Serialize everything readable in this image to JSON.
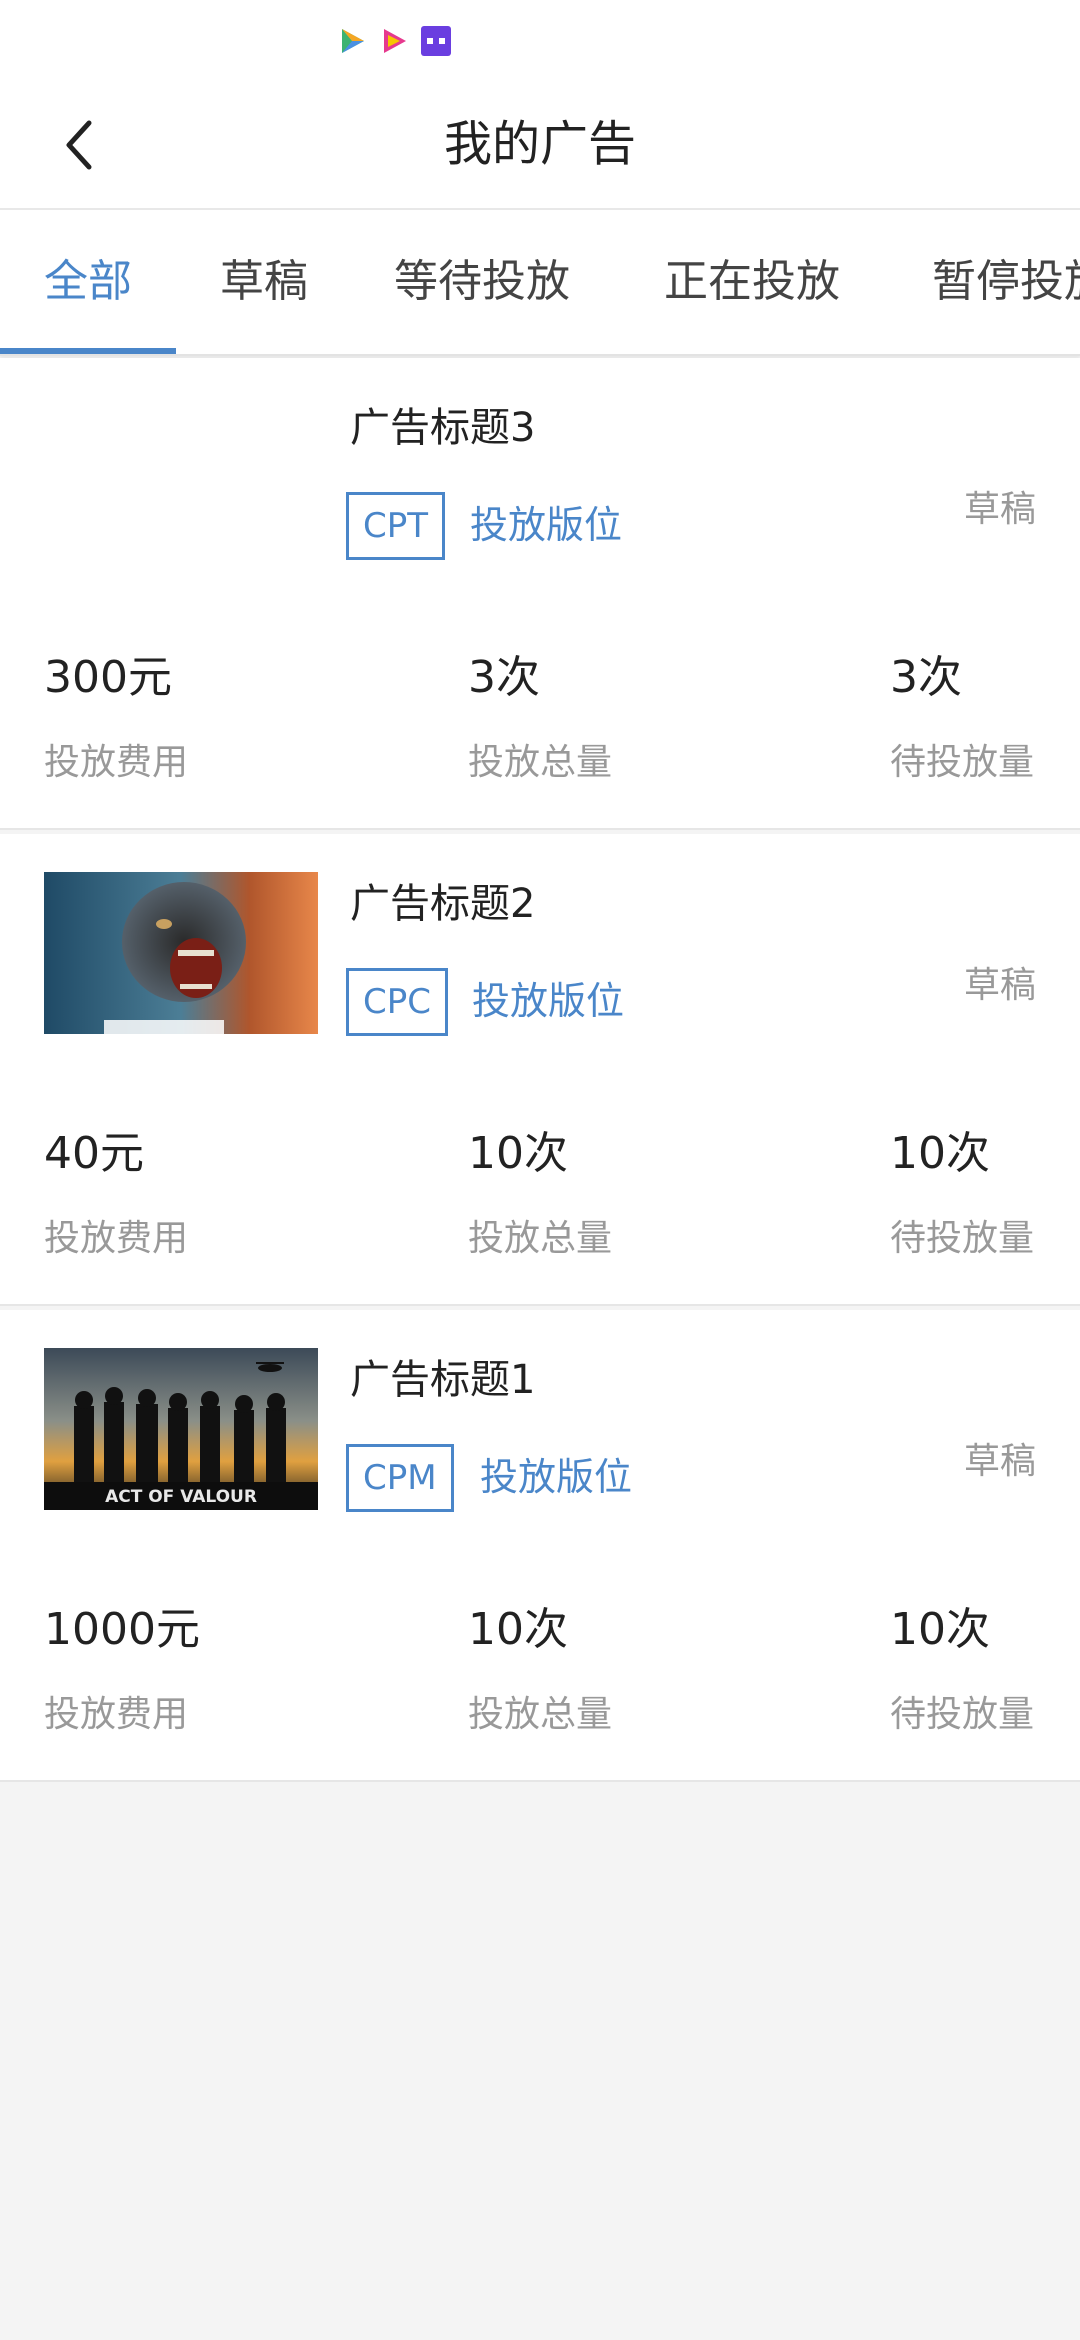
{
  "header": {
    "title": "我的广告",
    "back_icon": "chevron-left-icon"
  },
  "status_bar": {
    "icons": [
      "app-icon-1",
      "app-icon-2",
      "app-icon-3"
    ]
  },
  "tabs": [
    {
      "label": "全部",
      "active": true
    },
    {
      "label": "草稿",
      "active": false
    },
    {
      "label": "等待投放",
      "active": false
    },
    {
      "label": "正在投放",
      "active": false
    },
    {
      "label": "暂停投放",
      "active": false
    }
  ],
  "colors": {
    "accent": "#4a86c9",
    "muted": "#999999",
    "text": "#222222"
  },
  "ads": [
    {
      "title": "广告标题3",
      "type": "CPT",
      "slot_label": "投放版位",
      "status": "草稿",
      "has_image": false,
      "stats": [
        {
          "value": "300元",
          "label": "投放费用"
        },
        {
          "value": "3次",
          "label": "投放总量"
        },
        {
          "value": "3次",
          "label": "待投放量"
        }
      ]
    },
    {
      "title": "广告标题2",
      "type": "CPC",
      "slot_label": "投放版位",
      "status": "草稿",
      "has_image": true,
      "stats": [
        {
          "value": "40元",
          "label": "投放费用"
        },
        {
          "value": "10次",
          "label": "投放总量"
        },
        {
          "value": "10次",
          "label": "待投放量"
        }
      ]
    },
    {
      "title": "广告标题1",
      "type": "CPM",
      "slot_label": "投放版位",
      "status": "草稿",
      "has_image": true,
      "image_caption": "ACT OF VALOUR",
      "stats": [
        {
          "value": "1000元",
          "label": "投放费用"
        },
        {
          "value": "10次",
          "label": "投放总量"
        },
        {
          "value": "10次",
          "label": "待投放量"
        }
      ]
    }
  ]
}
